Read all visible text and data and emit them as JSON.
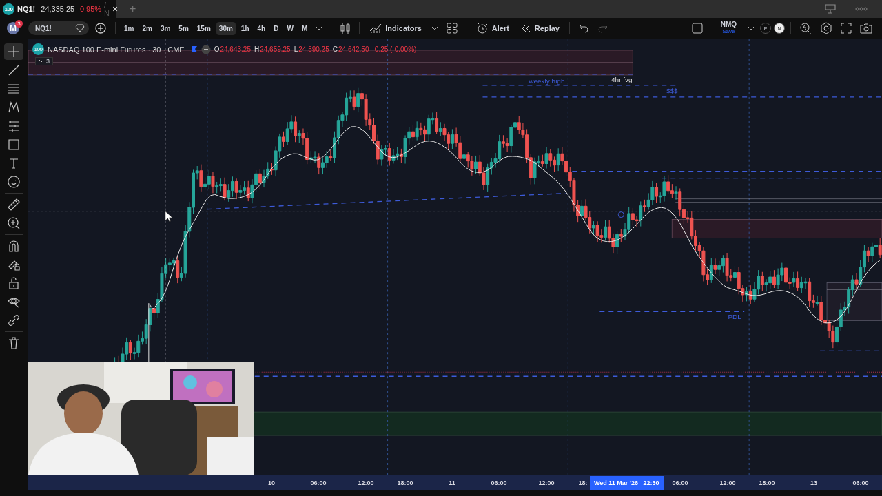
{
  "browser_tab": {
    "logo": "100",
    "symbol": "NQ1!",
    "price": "24,335.25",
    "change": "-0.95%",
    "extra": "/ N",
    "close": "×",
    "new_tab": "+"
  },
  "toolbar": {
    "avatar": "M",
    "notifications": "3",
    "symbol": "NQ1!",
    "intervals": [
      {
        "label": "1m",
        "selected": false
      },
      {
        "label": "2m",
        "selected": false
      },
      {
        "label": "3m",
        "selected": false
      },
      {
        "label": "5m",
        "selected": false
      },
      {
        "label": "15m",
        "selected": false
      },
      {
        "label": "30m",
        "selected": true
      },
      {
        "label": "1h",
        "selected": false
      },
      {
        "label": "4h",
        "selected": false
      },
      {
        "label": "D",
        "selected": false
      },
      {
        "label": "W",
        "selected": false
      },
      {
        "label": "M",
        "selected": false
      }
    ],
    "indicators": "Indicators",
    "alert": "Alert",
    "replay": "Replay",
    "layout_name": "NMQ",
    "layout_status": "Save",
    "badges": [
      "E",
      "N"
    ]
  },
  "tools": [
    {
      "kind": "crosshair",
      "selected": true
    },
    {
      "kind": "trendline",
      "selected": false
    },
    {
      "kind": "fib",
      "selected": false
    },
    {
      "kind": "pattern",
      "selected": false
    },
    {
      "kind": "projection",
      "selected": false
    },
    {
      "kind": "rectangle",
      "selected": false
    },
    {
      "kind": "text",
      "selected": false
    },
    {
      "kind": "emoji",
      "selected": false
    },
    {
      "kind": "ruler",
      "selected": false
    },
    {
      "kind": "zoom",
      "selected": false
    },
    {
      "kind": "magnet",
      "selected": false
    },
    {
      "kind": "lockdraw",
      "selected": false
    },
    {
      "kind": "lock",
      "selected": false
    },
    {
      "kind": "eye",
      "selected": false
    },
    {
      "kind": "link",
      "selected": false
    },
    {
      "kind": "trash",
      "selected": false
    }
  ],
  "legend": {
    "logo": "100",
    "title": "NASDAQ 100 E-mini Futures · 30 · CME",
    "ohlc": [
      {
        "label": "O",
        "value": "24,643.25"
      },
      {
        "label": "H",
        "value": "24,659.25"
      },
      {
        "label": "L",
        "value": "24,590.25"
      },
      {
        "label": "C",
        "value": "24,642.50"
      }
    ],
    "change": "-0.25 (-0.00%)",
    "indicator_count": "3"
  },
  "chart_labels": [
    {
      "kind": "level",
      "text": "weekly high"
    },
    {
      "kind": "zone",
      "text": "4hr fvg"
    },
    {
      "kind": "level",
      "text": "$$$"
    },
    {
      "kind": "level",
      "text": "PDL"
    }
  ],
  "time_axis": {
    "ticks": [
      "10",
      "06:00",
      "12:00",
      "18:00",
      "11",
      "06:00",
      "12:00",
      "18:",
      "06:00",
      "12:00",
      "18:00",
      "13",
      "06:00"
    ],
    "crosshair_label": "Wed 11 Mar '26   22:30"
  }
}
